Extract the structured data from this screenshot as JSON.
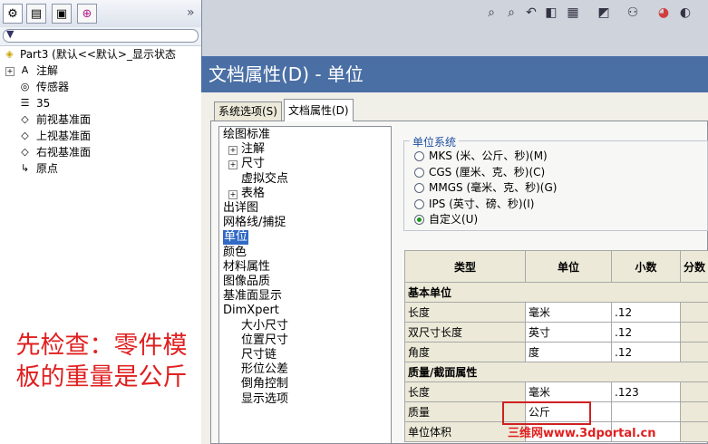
{
  "feature_manager": {
    "tabs": [
      "feature-manager-icon",
      "property-manager-icon",
      "configuration-manager-icon",
      "dimxpert-icon"
    ],
    "more": "»",
    "filter_icon": "filter-icon",
    "part_line": "Part3  (默认<<默认>_显示状态",
    "tree": [
      {
        "label": "注解",
        "icon": "annotation-icon",
        "expander": "+"
      },
      {
        "label": "传感器",
        "icon": "sensor-icon",
        "expander": ""
      },
      {
        "label": "35",
        "icon": "material-icon",
        "expander": ""
      },
      {
        "label": "前视基准面",
        "icon": "plane-icon",
        "expander": ""
      },
      {
        "label": "上视基准面",
        "icon": "plane-icon",
        "expander": ""
      },
      {
        "label": "右视基准面",
        "icon": "plane-icon",
        "expander": ""
      },
      {
        "label": "原点",
        "icon": "origin-icon",
        "expander": ""
      }
    ]
  },
  "annotation_note": "先检查：零件模板的重量是公斤",
  "toolbar": {
    "icons": [
      "zoom-fit-icon",
      "zoom-area-icon",
      "previous-view-icon",
      "section-view-icon",
      "view-orientation-icon",
      "display-style-icon",
      "hide-show-icon",
      "appearance-icon",
      "scene-icon"
    ]
  },
  "dialog": {
    "title": "文档属性(D)  -  单位",
    "tabs": [
      {
        "label": "系统选项(S)",
        "active": false
      },
      {
        "label": "文档属性(D)",
        "active": true
      }
    ],
    "nav": [
      {
        "label": "绘图标准",
        "indent": 0,
        "expander": ""
      },
      {
        "label": "注解",
        "indent": 1,
        "expander": "+"
      },
      {
        "label": "尺寸",
        "indent": 1,
        "expander": "+"
      },
      {
        "label": "虚拟交点",
        "indent": 1,
        "expander": ""
      },
      {
        "label": "表格",
        "indent": 1,
        "expander": "+"
      },
      {
        "label": "出详图",
        "indent": 0,
        "expander": ""
      },
      {
        "label": "网格线/捕捉",
        "indent": 0,
        "expander": ""
      },
      {
        "label": "单位",
        "indent": 0,
        "expander": "",
        "selected": true
      },
      {
        "label": "颜色",
        "indent": 0,
        "expander": ""
      },
      {
        "label": "材料属性",
        "indent": 0,
        "expander": ""
      },
      {
        "label": "图像品质",
        "indent": 0,
        "expander": ""
      },
      {
        "label": "基准面显示",
        "indent": 0,
        "expander": ""
      },
      {
        "label": "DimXpert",
        "indent": 0,
        "expander": ""
      },
      {
        "label": "大小尺寸",
        "indent": 1,
        "expander": ""
      },
      {
        "label": "位置尺寸",
        "indent": 1,
        "expander": ""
      },
      {
        "label": "尺寸链",
        "indent": 1,
        "expander": ""
      },
      {
        "label": "形位公差",
        "indent": 1,
        "expander": ""
      },
      {
        "label": "倒角控制",
        "indent": 1,
        "expander": ""
      },
      {
        "label": "显示选项",
        "indent": 1,
        "expander": ""
      }
    ],
    "unit_system": {
      "title": "单位系统",
      "options": [
        {
          "label": "MKS (米、公斤、秒)(M)",
          "selected": false
        },
        {
          "label": "CGS (厘米、克、秒)(C)",
          "selected": false
        },
        {
          "label": "MMGS (毫米、克、秒)(G)",
          "selected": false
        },
        {
          "label": "IPS (英寸、磅、秒)(I)",
          "selected": false
        },
        {
          "label": "自定义(U)",
          "selected": true
        }
      ]
    },
    "table": {
      "headers": [
        "类型",
        "单位",
        "小数",
        "分数"
      ],
      "sections": [
        {
          "title": "基本单位",
          "rows": [
            {
              "type": "长度",
              "unit": "毫米",
              "decimals": ".12"
            },
            {
              "type": "双尺寸长度",
              "unit": "英寸",
              "decimals": ".12"
            },
            {
              "type": "角度",
              "unit": "度",
              "decimals": ".12"
            }
          ]
        },
        {
          "title": "质量/截面属性",
          "rows": [
            {
              "type": "长度",
              "unit": "毫米",
              "decimals": ".123"
            },
            {
              "type": "质量",
              "unit": "公斤",
              "decimals": ""
            },
            {
              "type": "单位体积",
              "unit": "",
              "decimals": ""
            }
          ]
        }
      ]
    }
  },
  "watermark": "三维网www.3dportal.cn",
  "colors": {
    "title_bar": "#4a6fa5",
    "highlight": "#d02020",
    "selection": "#316ac5"
  }
}
